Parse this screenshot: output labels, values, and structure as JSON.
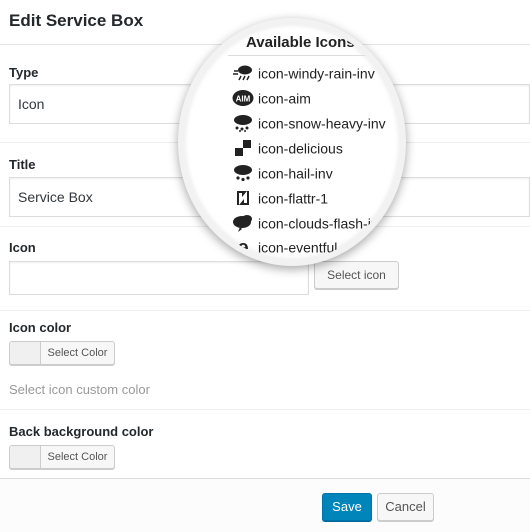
{
  "dialog": {
    "title": "Edit Service Box"
  },
  "fields": {
    "type": {
      "label": "Type",
      "value": "Icon"
    },
    "title": {
      "label": "Title",
      "value": "Service Box"
    },
    "icon": {
      "label": "Icon",
      "value": "",
      "button_label": "Select icon"
    },
    "icon_color": {
      "label": "Icon color",
      "button_label": "Select Color",
      "hint": "Select icon custom color"
    },
    "back_background_color": {
      "label": "Back background color",
      "button_label": "Select Color"
    }
  },
  "footer": {
    "save_label": "Save",
    "cancel_label": "Cancel"
  },
  "icon_picker": {
    "title": "Available Icons",
    "items": [
      {
        "name": "icon-windy-rain-inv",
        "icon": "windy-rain-icon"
      },
      {
        "name": "icon-aim",
        "icon": "aim-icon"
      },
      {
        "name": "icon-snow-heavy-inv",
        "icon": "snow-heavy-icon"
      },
      {
        "name": "icon-delicious",
        "icon": "delicious-icon"
      },
      {
        "name": "icon-hail-inv",
        "icon": "hail-icon"
      },
      {
        "name": "icon-flattr-1",
        "icon": "flattr-icon"
      },
      {
        "name": "icon-clouds-flash-inv",
        "icon": "clouds-flash-icon"
      },
      {
        "name": "icon-eventful",
        "icon": "eventful-icon"
      }
    ]
  },
  "colors": {
    "primary": "#0085ba",
    "border": "#dddddd",
    "hint": "#999999"
  }
}
